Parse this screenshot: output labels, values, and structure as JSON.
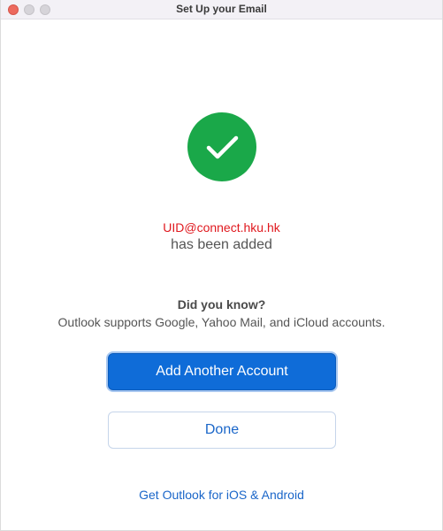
{
  "window": {
    "title": "Set Up your Email"
  },
  "status": {
    "icon": "checkmark-circle-icon",
    "color": "#1aa849",
    "email": "UID@connect.hku.hk",
    "email_color": "#e0181e",
    "message": "has been added"
  },
  "tip": {
    "heading": "Did you know?",
    "text": "Outlook supports Google, Yahoo Mail, and iCloud accounts."
  },
  "buttons": {
    "add_another": "Add Another Account",
    "done": "Done"
  },
  "footer": {
    "link": "Get Outlook for iOS & Android"
  },
  "colors": {
    "accent": "#0f6cd8",
    "link": "#1a66c9"
  }
}
